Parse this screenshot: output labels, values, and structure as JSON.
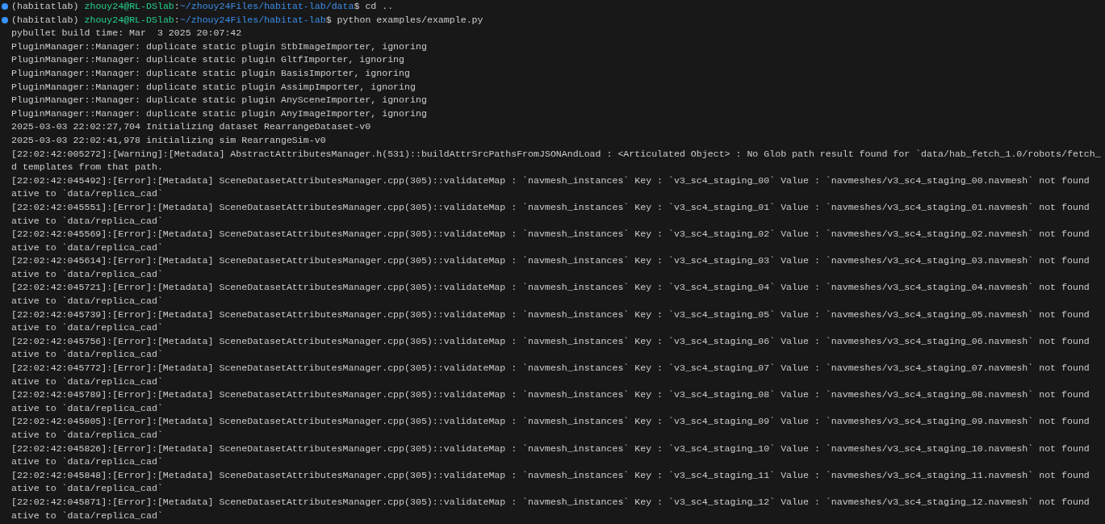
{
  "terminal": {
    "lines": [
      {
        "kind": "prompt",
        "env": "(habitatlab)",
        "user_host": "zhouy24@RL-DSlab",
        "separator": ":",
        "path": "~/zhouy24Files/habitat-lab/data",
        "command": "$ cd .."
      },
      {
        "kind": "prompt",
        "env": "(habitatlab)",
        "user_host": "zhouy24@RL-DSlab",
        "separator": ":",
        "path": "~/zhouy24Files/habitat-lab",
        "command": "$ python examples/example.py"
      },
      {
        "kind": "output",
        "text": "pybullet build time: Mar  3 2025 20:07:42"
      },
      {
        "kind": "output",
        "text": "PluginManager::Manager: duplicate static plugin StbImageImporter, ignoring"
      },
      {
        "kind": "output",
        "text": "PluginManager::Manager: duplicate static plugin GltfImporter, ignoring"
      },
      {
        "kind": "output",
        "text": "PluginManager::Manager: duplicate static plugin BasisImporter, ignoring"
      },
      {
        "kind": "output",
        "text": "PluginManager::Manager: duplicate static plugin AssimpImporter, ignoring"
      },
      {
        "kind": "output",
        "text": "PluginManager::Manager: duplicate static plugin AnySceneImporter, ignoring"
      },
      {
        "kind": "output",
        "text": "PluginManager::Manager: duplicate static plugin AnyImageImporter, ignoring"
      },
      {
        "kind": "output",
        "text": "2025-03-03 22:02:27,704 Initializing dataset RearrangeDataset-v0"
      },
      {
        "kind": "output",
        "text": "2025-03-03 22:02:41,978 initializing sim RearrangeSim-v0"
      },
      {
        "kind": "output",
        "text": "[22:02:42:005272]:[Warning]:[Metadata] AbstractAttributesManager.h(531)::buildAttrSrcPathsFromJSONAndLoad : <Articulated Object> : No Glob path result found for `data/hab_fetch_1.0/robots/fetch_"
      },
      {
        "kind": "output",
        "text": "d templates from that path."
      },
      {
        "kind": "output",
        "text": "[22:02:42:045492]:[Error]:[Metadata] SceneDatasetAttributesManager.cpp(305)::validateMap : `navmesh_instances` Key : `v3_sc4_staging_00` Value : `navmeshes/v3_sc4_staging_00.navmesh` not found"
      },
      {
        "kind": "output",
        "text": "ative to `data/replica_cad`"
      },
      {
        "kind": "output",
        "text": "[22:02:42:045551]:[Error]:[Metadata] SceneDatasetAttributesManager.cpp(305)::validateMap : `navmesh_instances` Key : `v3_sc4_staging_01` Value : `navmeshes/v3_sc4_staging_01.navmesh` not found"
      },
      {
        "kind": "output",
        "text": "ative to `data/replica_cad`"
      },
      {
        "kind": "output",
        "text": "[22:02:42:045569]:[Error]:[Metadata] SceneDatasetAttributesManager.cpp(305)::validateMap : `navmesh_instances` Key : `v3_sc4_staging_02` Value : `navmeshes/v3_sc4_staging_02.navmesh` not found"
      },
      {
        "kind": "output",
        "text": "ative to `data/replica_cad`"
      },
      {
        "kind": "output",
        "text": "[22:02:42:045614]:[Error]:[Metadata] SceneDatasetAttributesManager.cpp(305)::validateMap : `navmesh_instances` Key : `v3_sc4_staging_03` Value : `navmeshes/v3_sc4_staging_03.navmesh` not found"
      },
      {
        "kind": "output",
        "text": "ative to `data/replica_cad`"
      },
      {
        "kind": "output",
        "text": "[22:02:42:045721]:[Error]:[Metadata] SceneDatasetAttributesManager.cpp(305)::validateMap : `navmesh_instances` Key : `v3_sc4_staging_04` Value : `navmeshes/v3_sc4_staging_04.navmesh` not found"
      },
      {
        "kind": "output",
        "text": "ative to `data/replica_cad`"
      },
      {
        "kind": "output",
        "text": "[22:02:42:045739]:[Error]:[Metadata] SceneDatasetAttributesManager.cpp(305)::validateMap : `navmesh_instances` Key : `v3_sc4_staging_05` Value : `navmeshes/v3_sc4_staging_05.navmesh` not found"
      },
      {
        "kind": "output",
        "text": "ative to `data/replica_cad`"
      },
      {
        "kind": "output",
        "text": "[22:02:42:045756]:[Error]:[Metadata] SceneDatasetAttributesManager.cpp(305)::validateMap : `navmesh_instances` Key : `v3_sc4_staging_06` Value : `navmeshes/v3_sc4_staging_06.navmesh` not found"
      },
      {
        "kind": "output",
        "text": "ative to `data/replica_cad`"
      },
      {
        "kind": "output",
        "text": "[22:02:42:045772]:[Error]:[Metadata] SceneDatasetAttributesManager.cpp(305)::validateMap : `navmesh_instances` Key : `v3_sc4_staging_07` Value : `navmeshes/v3_sc4_staging_07.navmesh` not found"
      },
      {
        "kind": "output",
        "text": "ative to `data/replica_cad`"
      },
      {
        "kind": "output",
        "text": "[22:02:42:045789]:[Error]:[Metadata] SceneDatasetAttributesManager.cpp(305)::validateMap : `navmesh_instances` Key : `v3_sc4_staging_08` Value : `navmeshes/v3_sc4_staging_08.navmesh` not found"
      },
      {
        "kind": "output",
        "text": "ative to `data/replica_cad`"
      },
      {
        "kind": "output",
        "text": "[22:02:42:045805]:[Error]:[Metadata] SceneDatasetAttributesManager.cpp(305)::validateMap : `navmesh_instances` Key : `v3_sc4_staging_09` Value : `navmeshes/v3_sc4_staging_09.navmesh` not found"
      },
      {
        "kind": "output",
        "text": "ative to `data/replica_cad`"
      },
      {
        "kind": "output",
        "text": "[22:02:42:045826]:[Error]:[Metadata] SceneDatasetAttributesManager.cpp(305)::validateMap : `navmesh_instances` Key : `v3_sc4_staging_10` Value : `navmeshes/v3_sc4_staging_10.navmesh` not found"
      },
      {
        "kind": "output",
        "text": "ative to `data/replica_cad`"
      },
      {
        "kind": "output",
        "text": "[22:02:42:045848]:[Error]:[Metadata] SceneDatasetAttributesManager.cpp(305)::validateMap : `navmesh_instances` Key : `v3_sc4_staging_11` Value : `navmeshes/v3_sc4_staging_11.navmesh` not found"
      },
      {
        "kind": "output",
        "text": "ative to `data/replica_cad`"
      },
      {
        "kind": "output",
        "text": "[22:02:42:045871]:[Error]:[Metadata] SceneDatasetAttributesManager.cpp(305)::validateMap : `navmesh_instances` Key : `v3_sc4_staging_12` Value : `navmeshes/v3_sc4_staging_12.navmesh` not found"
      },
      {
        "kind": "output",
        "text": "ative to `data/replica_cad`"
      }
    ]
  }
}
